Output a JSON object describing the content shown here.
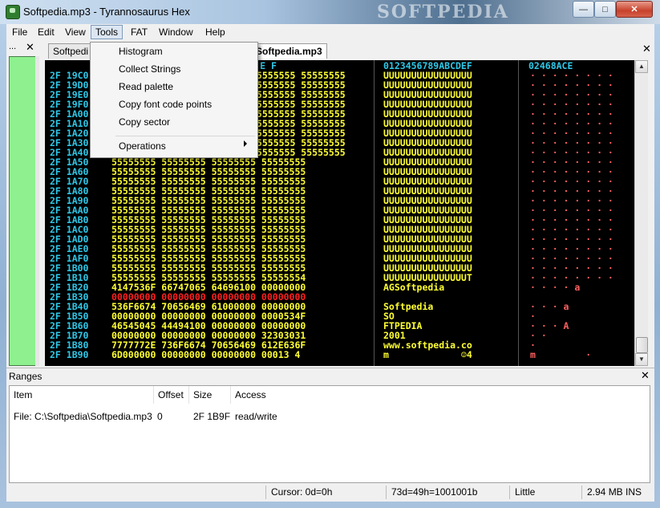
{
  "window": {
    "title": "Softpedia.mp3 - Tyrannosaurus Hex",
    "watermark": "SOFTPEDIA"
  },
  "menu": [
    "File",
    "Edit",
    "View",
    "Tools",
    "FAT",
    "Window",
    "Help"
  ],
  "tools_menu": {
    "items": [
      "Histogram",
      "Collect Strings",
      "Read palette",
      "Copy font code points",
      "Copy sector"
    ],
    "submenu": "Operations"
  },
  "left_panel": {
    "label": "..."
  },
  "tabs": [
    "Softpedi",
    "Softpedia.mp3"
  ],
  "hex": {
    "header_hex": "9 A B  C D E F",
    "header_ascii": "0123456789ABCDEF",
    "header_even": "02468ACE",
    "rows": [
      {
        "addr": "2F 19C0",
        "hex": "55555555 55555555",
        "ascii": "UUUUUUUUUUUUUUUU",
        "even": "· · · · · · · ·"
      },
      {
        "addr": "2F 19D0",
        "hex": "55555555 55555555",
        "ascii": "UUUUUUUUUUUUUUUU",
        "even": "· · · · · · · ·"
      },
      {
        "addr": "2F 19E0",
        "hex": "55555555 55555555",
        "ascii": "UUUUUUUUUUUUUUUU",
        "even": "· · · · · · · ·"
      },
      {
        "addr": "2F 19F0",
        "hex": "55555555 55555555",
        "ascii": "UUUUUUUUUUUUUUUU",
        "even": "· · · · · · · ·"
      },
      {
        "addr": "2F 1A00",
        "hex": "55555555 55555555",
        "ascii": "UUUUUUUUUUUUUUUU",
        "even": "· · · · · · · ·"
      },
      {
        "addr": "2F 1A10",
        "hex": "55555555 55555555",
        "ascii": "UUUUUUUUUUUUUUUU",
        "even": "· · · · · · · ·"
      },
      {
        "addr": "2F 1A20",
        "hex": "55555555 55555555",
        "ascii": "UUUUUUUUUUUUUUUU",
        "even": "· · · · · · · ·"
      },
      {
        "addr": "2F 1A30",
        "hex": "55555555 55555555",
        "ascii": "UUUUUUUUUUUUUUUU",
        "even": "· · · · · · · ·"
      },
      {
        "addr": "2F 1A40",
        "hex": "55555555 55555555",
        "ascii": "UUUUUUUUUUUUUUUU",
        "even": "· · · · · · · ·"
      },
      {
        "addr": "2F 1A50",
        "hex": "55555555 55555555 55555555 55555555",
        "ascii": "UUUUUUUUUUUUUUUU",
        "even": "· · · · · · · ·"
      },
      {
        "addr": "2F 1A60",
        "hex": "55555555 55555555 55555555 55555555",
        "ascii": "UUUUUUUUUUUUUUUU",
        "even": "· · · · · · · ·"
      },
      {
        "addr": "2F 1A70",
        "hex": "55555555 55555555 55555555 55555555",
        "ascii": "UUUUUUUUUUUUUUUU",
        "even": "· · · · · · · ·"
      },
      {
        "addr": "2F 1A80",
        "hex": "55555555 55555555 55555555 55555555",
        "ascii": "UUUUUUUUUUUUUUUU",
        "even": "· · · · · · · ·"
      },
      {
        "addr": "2F 1A90",
        "hex": "55555555 55555555 55555555 55555555",
        "ascii": "UUUUUUUUUUUUUUUU",
        "even": "· · · · · · · ·"
      },
      {
        "addr": "2F 1AA0",
        "hex": "55555555 55555555 55555555 55555555",
        "ascii": "UUUUUUUUUUUUUUUU",
        "even": "· · · · · · · ·"
      },
      {
        "addr": "2F 1AB0",
        "hex": "55555555 55555555 55555555 55555555",
        "ascii": "UUUUUUUUUUUUUUUU",
        "even": "· · · · · · · ·"
      },
      {
        "addr": "2F 1AC0",
        "hex": "55555555 55555555 55555555 55555555",
        "ascii": "UUUUUUUUUUUUUUUU",
        "even": "· · · · · · · ·"
      },
      {
        "addr": "2F 1AD0",
        "hex": "55555555 55555555 55555555 55555555",
        "ascii": "UUUUUUUUUUUUUUUU",
        "even": "· · · · · · · ·"
      },
      {
        "addr": "2F 1AE0",
        "hex": "55555555 55555555 55555555 55555555",
        "ascii": "UUUUUUUUUUUUUUUU",
        "even": "· · · · · · · ·"
      },
      {
        "addr": "2F 1AF0",
        "hex": "55555555 55555555 55555555 55555555",
        "ascii": "UUUUUUUUUUUUUUUU",
        "even": "· · · · · · · ·"
      },
      {
        "addr": "2F 1B00",
        "hex": "55555555 55555555 55555555 55555555",
        "ascii": "UUUUUUUUUUUUUUUU",
        "even": "· · · · · · · ·"
      },
      {
        "addr": "2F 1B10",
        "hex": "55555555 55555555 55555555 55555554",
        "ascii": "UUUUUUUUUUUUUUUT",
        "even": "· · · · · · · ·"
      },
      {
        "addr": "2F 1B20",
        "hex": "4147536F 66747065 64696100 00000000",
        "ascii": "AGSoftpedia",
        "even": "· · · · a"
      },
      {
        "addr": "2F 1B30",
        "hex": "00000000 00000000 00000000 00000000",
        "ascii": "",
        "even": ""
      },
      {
        "addr": "2F 1B40",
        "hex": "536F6674 70656469 61000000 00000000",
        "ascii": "Softpedia",
        "even": "· · · a"
      },
      {
        "addr": "2F 1B50",
        "hex": "00000000 00000000 00000000 0000534F",
        "ascii": "SO",
        "even": "·"
      },
      {
        "addr": "2F 1B60",
        "hex": "46545045 44494100 00000000 00000000",
        "ascii": "FTPEDIA",
        "even": "· · · A"
      },
      {
        "addr": "2F 1B70",
        "hex": "00000000 00000000 00000000 32303031",
        "ascii": "2001",
        "even": "· ·"
      },
      {
        "addr": "2F 1B80",
        "hex": "7777772E 736F6674 70656469 612E636F",
        "ascii": "www.softpedia.co",
        "even": "·"
      },
      {
        "addr": "2F 1B90",
        "hex": "6D000000 00000000 00000000 00013 4",
        "ascii": "m             ☺4",
        "even": "m         ·"
      }
    ]
  },
  "ranges": {
    "title": "Ranges",
    "columns": [
      "Item",
      "Offset",
      "Size",
      "Access"
    ],
    "row": {
      "item": "File: C:\\Softpedia\\Softpedia.mp3",
      "offset": "0",
      "size": "2F 1B9F",
      "access": "read/write"
    }
  },
  "status": {
    "cursor": "Cursor: 0d=0h",
    "value": "73d=49h=1001001b",
    "endian": "Little",
    "size": "2.94 MB INS"
  },
  "colors": {
    "addr": "#2ec8e8",
    "hex55": "#ffff33",
    "zero": "#ff2020",
    "ascii": "#ffff33",
    "grid_bg": "#000000",
    "panel_green": "#8ef08e"
  }
}
